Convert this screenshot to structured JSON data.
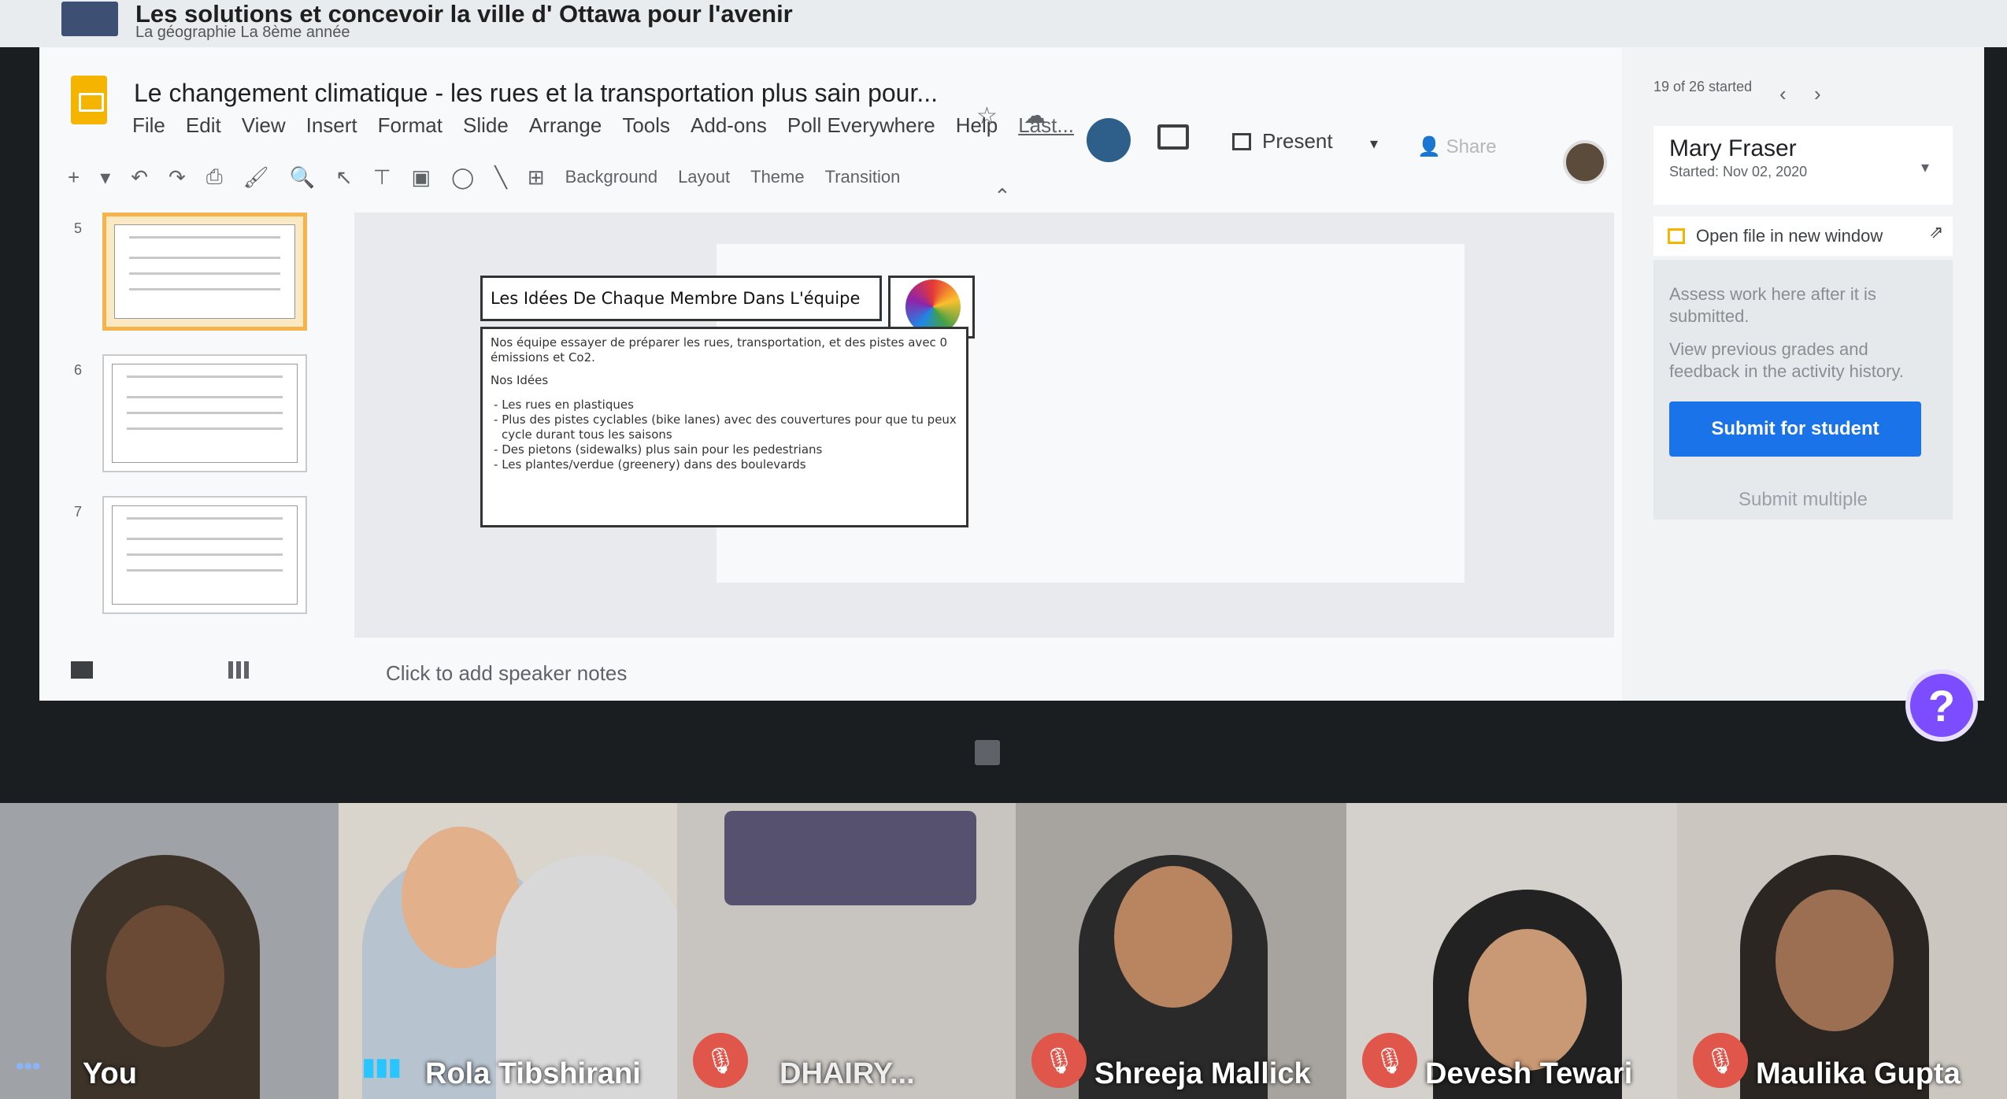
{
  "classroom": {
    "assignment_title": "Les solutions et concevoir la ville d' Ottawa pour l'avenir",
    "course_subtitle": "La géographie La 8ème année"
  },
  "slides": {
    "doc_title": "Le changement climatique - les rues et la transportation plus sain pour...",
    "menu": [
      "File",
      "Edit",
      "View",
      "Insert",
      "Format",
      "Slide",
      "Arrange",
      "Tools",
      "Add-ons",
      "Poll Everywhere",
      "Help"
    ],
    "last_edit": "Last...",
    "present_label": "Present",
    "share_label": "Share",
    "toolbar": {
      "background": "Background",
      "layout": "Layout",
      "theme": "Theme",
      "transition": "Transition"
    },
    "thumbnails": [
      {
        "number": "5",
        "selected": true
      },
      {
        "number": "6",
        "selected": false
      },
      {
        "number": "7",
        "selected": false
      }
    ],
    "current_slide": {
      "title": "Les Idées De Chaque Membre Dans L'équipe",
      "intro": "Nos équipe essayer de préparer les rues, transportation, et des pistes avec 0 émissions et Co2.",
      "section": "Nos Idées",
      "ideas": [
        "Les rues en plastiques",
        "Plus des pistes cyclables (bike lanes) avec des couvertures pour que tu peux cycle durant tous les saisons",
        "Des pietons (sidewalks) plus sain pour les pedestrians",
        "Les plantes/verdue (greenery) dans des boulevards"
      ]
    },
    "speaker_notes_placeholder": "Click to add speaker notes"
  },
  "grading_panel": {
    "started_count": "19 of 26 started",
    "student_name": "Mary Fraser",
    "student_started": "Started: Nov 02, 2020",
    "open_file": "Open file in new window",
    "assess_text": "Assess work here after it is submitted.",
    "history_text": "View previous grades and feedback in the activity history.",
    "submit_button": "Submit for student",
    "submit_multiple": "Submit multiple",
    "help_glyph": "?"
  },
  "participants": [
    {
      "name": "You",
      "muted": false,
      "speaking": false
    },
    {
      "name": "Rola Tibshirani",
      "muted": false,
      "speaking": true
    },
    {
      "name": "DHAIRY...",
      "muted": true,
      "speaking": false
    },
    {
      "name": "Shreeja Mallick",
      "muted": true,
      "speaking": false
    },
    {
      "name": "Devesh Tewari",
      "muted": true,
      "speaking": false
    },
    {
      "name": "Maulika Gupta",
      "muted": true,
      "speaking": false
    }
  ],
  "colors": {
    "accent_blue": "#1a73e8",
    "slides_yellow": "#f4b400",
    "help_purple": "#7c4dff",
    "mute_red": "#e0564b"
  }
}
